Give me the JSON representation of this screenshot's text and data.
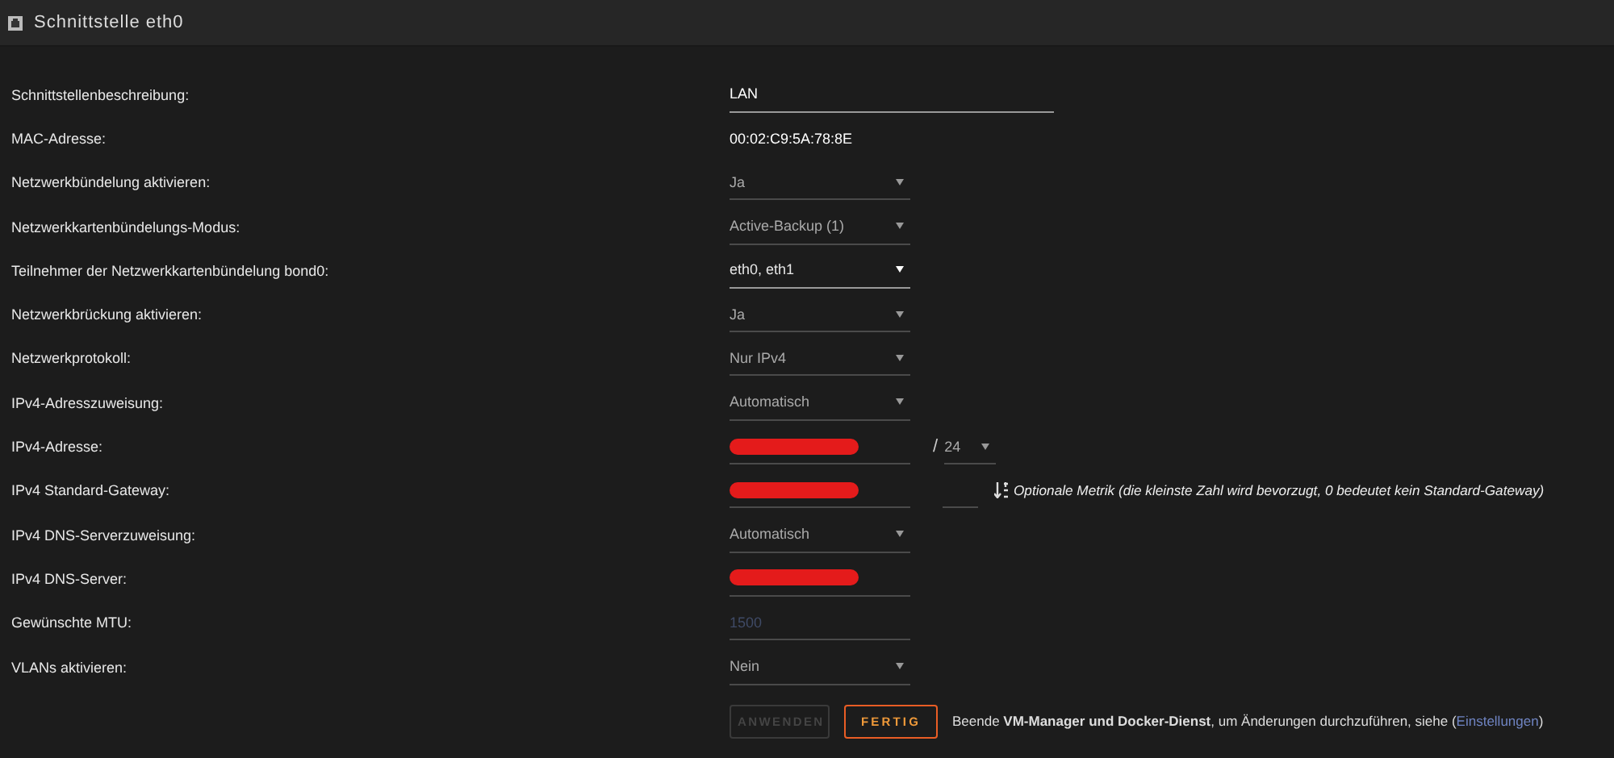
{
  "header": {
    "title": "Schnittstelle eth0"
  },
  "rows": [
    {
      "label": "Schnittstellenbeschreibung:",
      "control": {
        "kind": "text",
        "value": "LAN"
      }
    },
    {
      "label": "MAC-Adresse:",
      "control": {
        "kind": "static",
        "value": "00:02:C9:5A:78:8E"
      }
    },
    {
      "label": "Netzwerkbündelung aktivieren:",
      "control": {
        "kind": "select",
        "value": "Ja"
      }
    },
    {
      "label": "Netzwerkkartenbündelungs-Modus:",
      "control": {
        "kind": "select",
        "value": "Active-Backup (1)"
      }
    },
    {
      "label": "Teilnehmer der Netzwerkkartenbündelung bond0:",
      "control": {
        "kind": "multiselect",
        "value": "eth0, eth1"
      }
    },
    {
      "label": "Netzwerkbrückung aktivieren:",
      "control": {
        "kind": "select",
        "value": "Ja"
      }
    },
    {
      "label": "Netzwerkprotokoll:",
      "control": {
        "kind": "select",
        "value": "Nur IPv4"
      }
    },
    {
      "label": "IPv4-Adresszuweisung:",
      "control": {
        "kind": "select",
        "value": "Automatisch"
      }
    },
    {
      "label": "IPv4-Adresse:",
      "control": {
        "kind": "redacted"
      },
      "extra": {
        "kind": "prefix",
        "separator": "/",
        "value": "24"
      }
    },
    {
      "label": "IPv4 Standard-Gateway:",
      "control": {
        "kind": "redacted"
      },
      "extra": {
        "kind": "metric",
        "note": "Optionale Metrik (die kleinste Zahl wird bevorzugt, 0 bedeutet kein Standard-Gateway)"
      }
    },
    {
      "label": "IPv4 DNS-Serverzuweisung:",
      "control": {
        "kind": "select",
        "value": "Automatisch"
      }
    },
    {
      "label": "IPv4 DNS-Server:",
      "control": {
        "kind": "redacted"
      }
    },
    {
      "label": "Gewünschte MTU:",
      "control": {
        "kind": "number",
        "placeholder": "1500"
      }
    },
    {
      "label": "VLANs aktivieren:",
      "control": {
        "kind": "select",
        "value": "Nein"
      }
    }
  ],
  "buttons": [
    {
      "label": "ANWENDEN",
      "disabled": true
    },
    {
      "label": "FERTIG",
      "disabled": false
    }
  ],
  "footer_note": {
    "text": "Beende **VM-Manager und Docker-Dienst**, um Änderungen durchzuführen, siehe (",
    "link": "Einstellungen",
    "close": ")"
  }
}
